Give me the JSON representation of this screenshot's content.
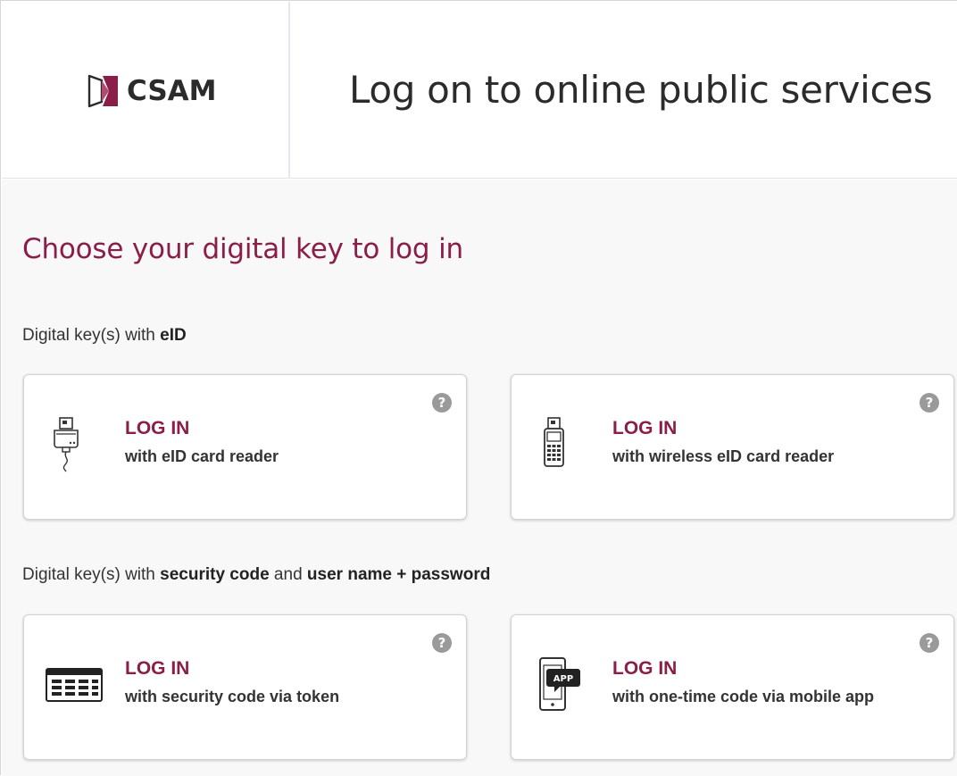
{
  "header": {
    "logo_text": "CSAM",
    "title": "Log on to online public services"
  },
  "main": {
    "page_title": "Choose your digital key to log in",
    "sections": [
      {
        "prefix": "Digital key(s) with ",
        "bold": "eID"
      },
      {
        "prefix": "Digital key(s) with ",
        "bold": "security code",
        "middle": " and ",
        "bold2": "user name + password"
      }
    ],
    "cards": [
      {
        "title": "LOG IN",
        "subtitle": "with eID card reader",
        "icon": "eid-card-reader-icon"
      },
      {
        "title": "LOG IN",
        "subtitle": "with wireless eID card reader",
        "icon": "wireless-eid-card-reader-icon"
      },
      {
        "title": "LOG IN",
        "subtitle": "with security code via token",
        "icon": "security-token-icon"
      },
      {
        "title": "LOG IN",
        "subtitle": "with one-time code via mobile app",
        "icon": "mobile-app-icon"
      }
    ],
    "help_glyph": "?",
    "app_badge": "APP"
  },
  "colors": {
    "accent": "#8a1e48",
    "text": "#333333",
    "background": "#f8f8f8",
    "help_icon": "#9a9a9a"
  }
}
